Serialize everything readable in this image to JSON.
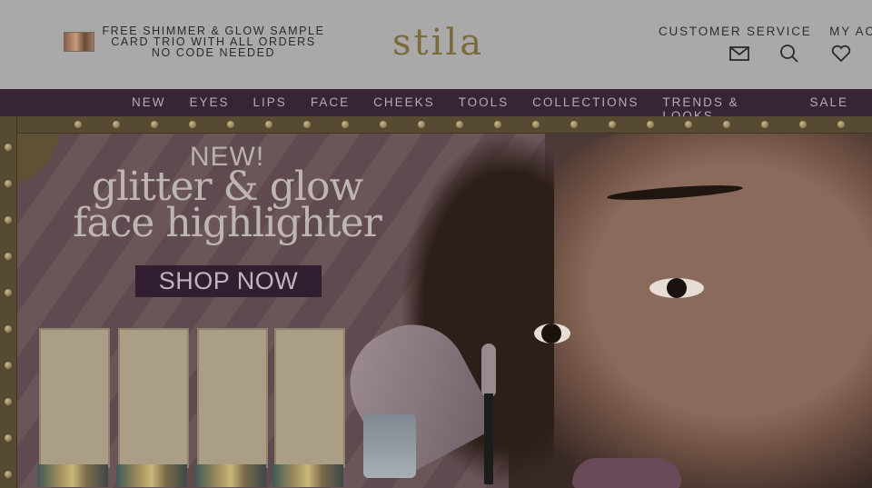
{
  "header": {
    "promo": {
      "lines": [
        "FREE SHIMMER & GLOW SAMPLE",
        "CARD TRIO WITH ALL ORDERS",
        "NO CODE NEEDED"
      ],
      "thumbnail_alt": "sample cards"
    },
    "logo_text": "stila",
    "links": {
      "customer_service": "CUSTOMER SERVICE",
      "my_account": "MY ACCO"
    },
    "icons": [
      "mail-icon",
      "search-icon",
      "heart-icon"
    ]
  },
  "nav": {
    "items": [
      "NEW",
      "EYES",
      "LIPS",
      "FACE",
      "CHEEKS",
      "TOOLS",
      "COLLECTIONS",
      "TRENDS & LOOKS",
      "SALE"
    ]
  },
  "hero": {
    "kicker": "NEW!",
    "title_line1": "glitter & glow",
    "title_line2": "face highlighter",
    "cta": "SHOP NOW"
  },
  "colors": {
    "nav_bg": "#372536",
    "cta_bg": "#321e31",
    "logo": "#7b6a3c"
  }
}
